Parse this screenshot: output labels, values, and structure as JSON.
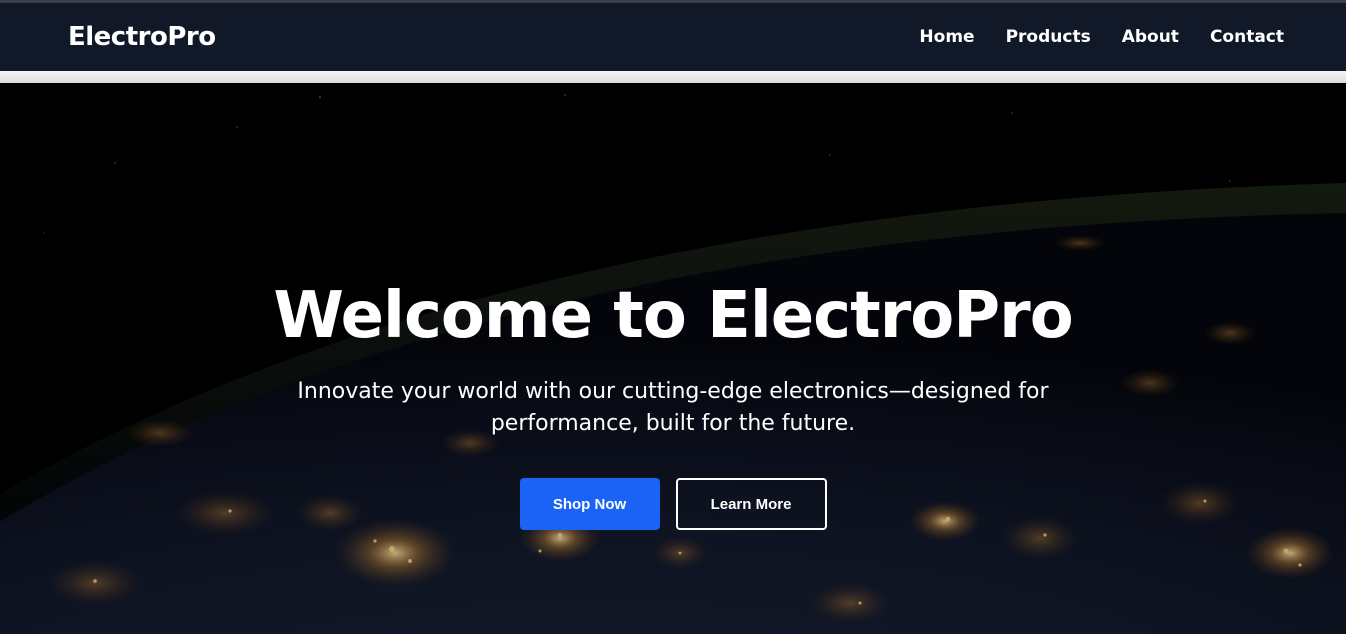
{
  "navbar": {
    "brand": "ElectroPro",
    "links": [
      "Home",
      "Products",
      "About",
      "Contact"
    ]
  },
  "hero": {
    "title": "Welcome to ElectroPro",
    "subtitle": "Innovate your world with our cutting-edge electronics—designed for performance, built for the future.",
    "primary_button": "Shop Now",
    "secondary_button": "Learn More"
  },
  "colors": {
    "navbar_bg": "#111827",
    "primary_button": "#1a63f5",
    "text": "#ffffff"
  }
}
